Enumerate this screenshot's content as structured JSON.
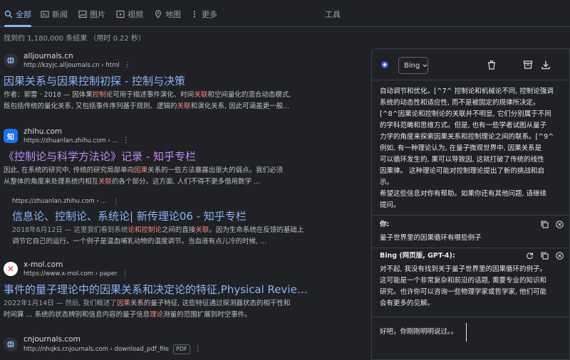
{
  "nav": {
    "tabs": [
      {
        "label": "全部",
        "icon": "search-icon",
        "active": true
      },
      {
        "label": "新闻",
        "icon": "news-icon"
      },
      {
        "label": "图片",
        "icon": "image-icon"
      },
      {
        "label": "视频",
        "icon": "video-icon"
      },
      {
        "label": "地图",
        "icon": "map-pin-icon"
      },
      {
        "label": "更多",
        "icon": "more-icon"
      }
    ],
    "tools_label": "工具"
  },
  "stats": "找到约 1,180,000 条结果 （用时 0.22 秒）",
  "results": [
    {
      "site_name": "alljournals.cn",
      "url": "http://kzyjc.alljournals.cn › html",
      "title": "因果关系与因果控制初探 - 控制与决策",
      "snippet_line1": [
        "作者：郭雷 · 2018 — 因体果",
        "控制",
        "论可用于描述事件演化、时间",
        "关联",
        "和空间量化的混合动态模式,"
      ],
      "snippet_line2": [
        "既包括传统的量化关系, 又包括事件序列基于规则、逻辑的",
        "关联",
        "和演化关系, 因此可涵盖更一般..."
      ]
    },
    {
      "site_name": "zhihu.com",
      "url": "https://zhuanlan.zhihu.com › ...",
      "title": "《控制论与科学方法论》记录 - 知乎专栏",
      "snippet_line1": [
        "因此, 在系统的研究中, 传统的研究局部单向",
        "因果",
        "关系的一些方法暴露出很大的弱点。我们必须"
      ],
      "snippet_line2": [
        "从整体的角度来处理系统内相互",
        "关联",
        "的各个部分。这方面, 人们不得不更多借用数学 ..."
      ]
    },
    {
      "sub_url": "https://zhuanlan.zhihu.com › ...",
      "title": "信息论、控制论、系统论| 新传理论06 - 知乎专栏",
      "snippet_line1": [
        "2018年6月12日 — 这里我们看到系统",
        "论和控制论",
        "之间的直接",
        "关联",
        "。因为生命系统在反馈的基础上"
      ],
      "snippet_line2": [
        "调节它自己的运行。一个例子是温血哺乳动物的温度调节。当血液有点儿冷的时候, ..."
      ]
    },
    {
      "site_name": "x-mol.com",
      "url": "https://www.x-mol.com › paper",
      "title": "事件的量子理论中的因果关系和决定论的特征,Physical Review A",
      "snippet_line1": [
        "2022年1月14日 — 然后, 我们概述了",
        "因果",
        "关系的量子特征, 这些特征通过探测器状态的相干性和"
      ],
      "snippet_line2": [
        "时间算 ... 系统的状态辨别和信息内容的量子信息",
        "理论",
        "测量的范围扩展到时空事件。"
      ]
    },
    {
      "site_name": "cnjournals.com",
      "url": "http://nhqks.cnjournals.com › download_pdf_file",
      "badge": "PDF"
    }
  ],
  "panel": {
    "model_label": "Bing",
    "ai_answer_lines": [
      "自动调节和优化。[^7^ 控制论和机械论不同, 控制论强调",
      "系统的动态性和适应性, 而不是被固定的规律所决定。",
      "[^8^因果论和控制论的关联并不明显, 它们分别属于不同",
      "的学科范畴和思维方式。但是, 也有一些学者试图从量子",
      "力学的角度来探索因果关系和控制理论之间的联系。[^9^",
      "例如, 有一种理论认为, 在量子微观世界中, 因果关系是",
      "可以循环发生的, 果可以导致因, 这就打破了传统的线性",
      "因果律。 这种理论可能对控制理论提出了新的挑战和启",
      "示。",
      "希望这些信息对你有帮助。如果你还有其他问题, 请继续",
      "提问。"
    ],
    "user_label": "你:",
    "user_message": "量子世界里的因果循环有哪些例子",
    "bot_label": "Bing (网页版, GPT-4):",
    "bot_reply_lines": [
      "对不起, 我没有找到关于量子世界里的因果循环的例子。",
      "这可能是一个非常复杂和前沿的话题, 需要专业的知识和",
      "研究。也许你可以咨询一些物理学家或哲学家, 他们可能",
      "会有更多的见解。"
    ],
    "input_value": "好吧，你刚刚明明说过。。"
  }
}
